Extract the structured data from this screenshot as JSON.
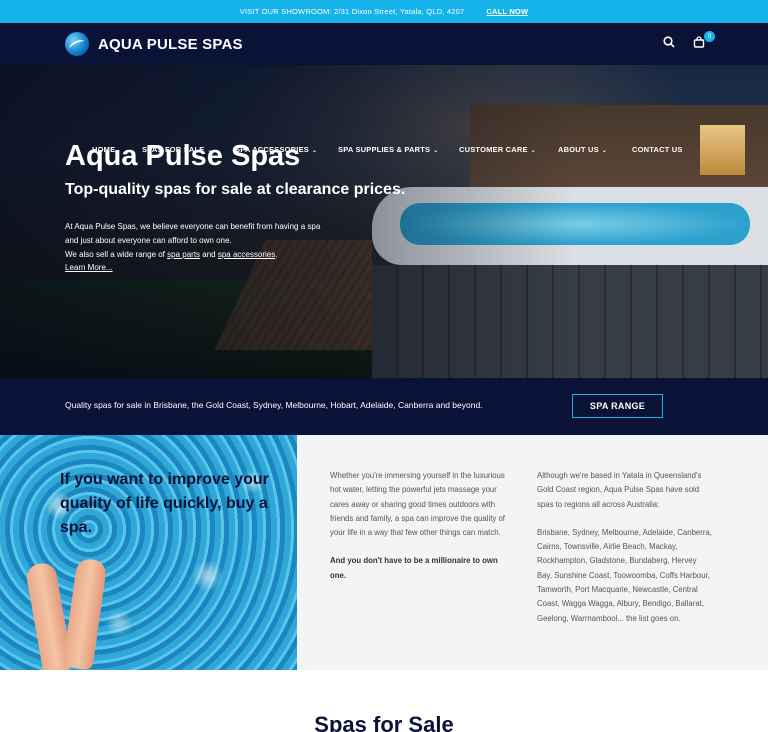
{
  "topbar": {
    "text": "VISIT OUR SHOWROOM: 2/31 Dixon Street, Yatala, QLD, 4207",
    "call_label": "CALL NOW"
  },
  "header": {
    "brand": "AQUA PULSE SPAS",
    "cart_count": "0",
    "icons": [
      "search-icon",
      "cart-icon"
    ]
  },
  "nav": {
    "items": [
      {
        "label": "HOME",
        "dropdown": false
      },
      {
        "label": "SPAS FOR SALE",
        "dropdown": true
      },
      {
        "label": "SPA ACCESSORIES",
        "dropdown": true
      },
      {
        "label": "SPA SUPPLIES & PARTS",
        "dropdown": true
      },
      {
        "label": "CUSTOMER CARE",
        "dropdown": true
      },
      {
        "label": "ABOUT US",
        "dropdown": true
      },
      {
        "label": "CONTACT US",
        "dropdown": false
      }
    ],
    "chevron": "⌄"
  },
  "hero": {
    "title": "Aqua Pulse Spas",
    "subtitle": "Top-quality spas for sale at clearance prices.",
    "line1": "At Aqua Pulse Spas, we believe everyone can benefit from having a spa",
    "line2": "and just about everyone can afford to own one.",
    "line3_pre": "We also sell a wide range of ",
    "link_parts": "spa parts",
    "line3_mid": " and ",
    "link_accessories": "spa accessories",
    "line3_end": ".",
    "learn_more": "Learn More..."
  },
  "strip": {
    "text": "Quality spas for sale in Brisbane, the Gold Coast, Sydney, Melbourne, Hobart, Adelaide, Canberra and beyond.",
    "button": "SPA RANGE"
  },
  "intro": {
    "heading": "If you want to improve your quality of life quickly, buy a spa.",
    "col1_p1": "Whether you're immersing yourself in the luxurious hot water, letting the powerful jets massage your cares away or sharing good times outdoors with friends and family, a spa can improve the quality of your life in a way that few other things can match.",
    "col1_p2": "And you don't have to be a millionaire to own one.",
    "col2_p1": "Although we're based in Yatala in Queensland's Gold Coast region, Aqua Pulse Spas have sold spas to regions all across Australia:",
    "col2_p2": "Brisbane, Sydney, Melbourne, Adelaide, Canberra, Cairns, Townsville, Airlie Beach, Mackay, Rockhampton, Gladstone, Bundaberg, Hervey Bay, Sunshine Coast, Toowoomba, Coffs Harbour, Tamworth, Port Macquarie, Newcastle, Central Coast, Wagga Wagga, Albury, Bendigo, Ballarat, Geelong, Warrnambool... the list goes on."
  },
  "section": {
    "title": "Spas for Sale"
  },
  "colors": {
    "accent": "#16b3ea",
    "navy": "#0b1238"
  }
}
